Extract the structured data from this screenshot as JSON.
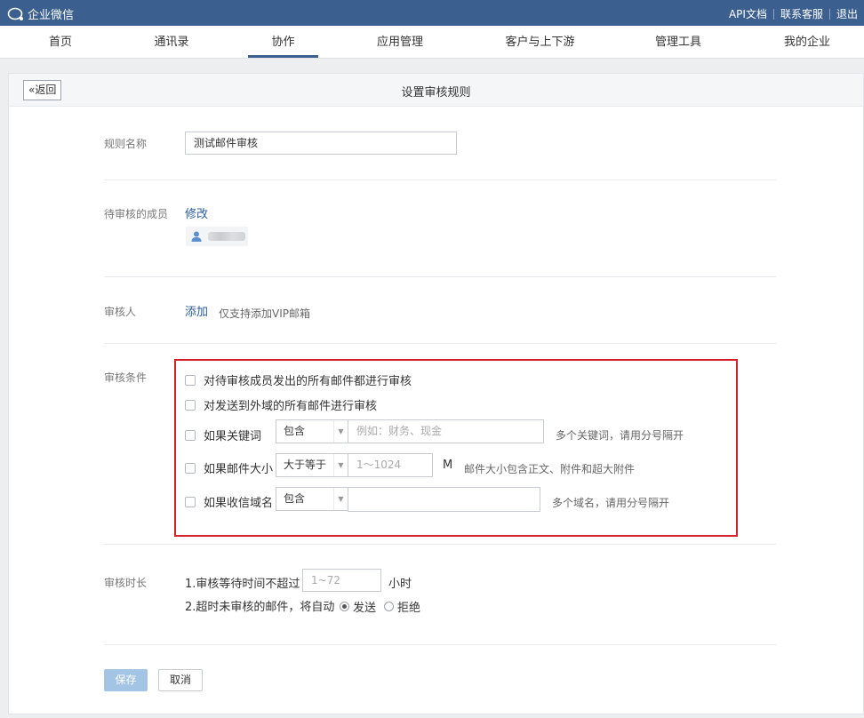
{
  "topbar": {
    "logo_text": "企业微信",
    "links": [
      "API文档",
      "联系客服",
      "退出"
    ]
  },
  "nav": {
    "items": [
      "首页",
      "通讯录",
      "协作",
      "应用管理",
      "客户与上下游",
      "管理工具",
      "我的企业"
    ],
    "active": "协作"
  },
  "page": {
    "back_label": "«返回",
    "title": "设置审核规则"
  },
  "rule_name": {
    "label": "规则名称",
    "value": "测试邮件审核"
  },
  "members": {
    "label": "待审核的成员",
    "edit_link": "修改"
  },
  "reviewer": {
    "label": "审核人",
    "add_link": "添加",
    "hint": "仅支持添加VIP邮箱"
  },
  "conditions": {
    "label": "审核条件",
    "all_outgoing": "对待审核成员发出的所有邮件都进行审核",
    "external_domain": "对发送到外域的所有邮件进行审核",
    "keyword": {
      "label": "如果关键词",
      "select": "包含",
      "placeholder": "例如：财务、现金",
      "hint": "多个关键词，请用分号隔开"
    },
    "size": {
      "label": "如果邮件大小",
      "select": "大于等于",
      "placeholder": "1～1024",
      "unit": "M",
      "hint": "邮件大小包含正文、附件和超大附件"
    },
    "domain": {
      "label": "如果收信域名",
      "select": "包含",
      "hint": "多个域名，请用分号隔开"
    }
  },
  "duration": {
    "label": "审核时长",
    "line1_prefix": "1.审核等待时间不超过",
    "hours_placeholder": "1~72",
    "line1_suffix": "小时",
    "line2_prefix": "2.超时未审核的邮件，将自动",
    "option_send": "发送",
    "option_reject": "拒绝",
    "selected": "发送"
  },
  "actions": {
    "save": "保存",
    "cancel": "取消"
  },
  "colors": {
    "topbar": "#3b5f8f",
    "link": "#2a5c9a",
    "highlight_border": "#d6212a",
    "save_button": "#a3c4e4"
  }
}
